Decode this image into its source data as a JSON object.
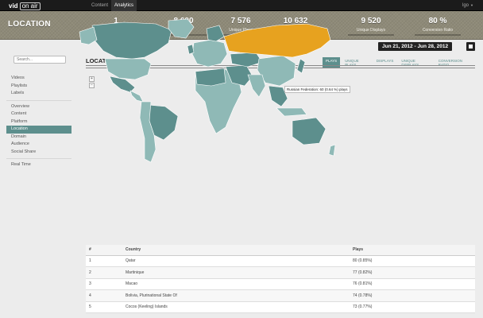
{
  "brand": {
    "vid": "vid",
    "onair": "on air"
  },
  "nav": {
    "tabs": [
      {
        "label": "Content"
      },
      {
        "label": "Analytics"
      }
    ]
  },
  "user": {
    "label": "lgo"
  },
  "header": {
    "title": "LOCATION",
    "kpis": [
      {
        "value": "1",
        "label": "Videos"
      },
      {
        "value": "8 600",
        "label": "Plays"
      },
      {
        "value": "7 576",
        "label": "Unique Plays"
      },
      {
        "value": "10 632",
        "label": "Displays"
      },
      {
        "value": "9 520",
        "label": "Unique Displays"
      },
      {
        "value": "80 %",
        "label": "Conversion Ratio"
      }
    ]
  },
  "daterange": {
    "label": "Jun 21, 2012 - Jun 28, 2012"
  },
  "search": {
    "placeholder": "Search..."
  },
  "sidebar": {
    "groups": [
      [
        "Videos",
        "Playlists",
        "Labels"
      ],
      [
        "Overview",
        "Content",
        "Platform",
        "Location",
        "Domain",
        "Audience",
        "Social Share"
      ],
      [
        "Real Time"
      ]
    ],
    "active": "Location"
  },
  "section": {
    "title": "LOCATION",
    "tabs": [
      "PLAYS",
      "UNIQUE PLAYS",
      "DISPLAYS",
      "UNIQUE DISPLAYS",
      "CONVERSION RATIO"
    ],
    "active_tab": "PLAYS"
  },
  "map": {
    "zoom_in": "+",
    "zoom_out": "−",
    "tooltip": "Russian Federation: 60 (0.64 %) plays",
    "highlight_color": "#e7a21f",
    "base_color": "#5d8f8d",
    "light_color": "#8fb9b6"
  },
  "table": {
    "headers": [
      "#",
      "Country",
      "Plays"
    ],
    "rows": [
      [
        "1",
        "Qatar",
        "80 (0.85%)"
      ],
      [
        "2",
        "Martinique",
        "77 (0.82%)"
      ],
      [
        "3",
        "Macao",
        "76 (0.81%)"
      ],
      [
        "4",
        "Bolivia, Plurinational State Of",
        "74 (0.78%)"
      ],
      [
        "5",
        "Cocos (Keeling) Islands",
        "73 (0.77%)"
      ]
    ]
  }
}
